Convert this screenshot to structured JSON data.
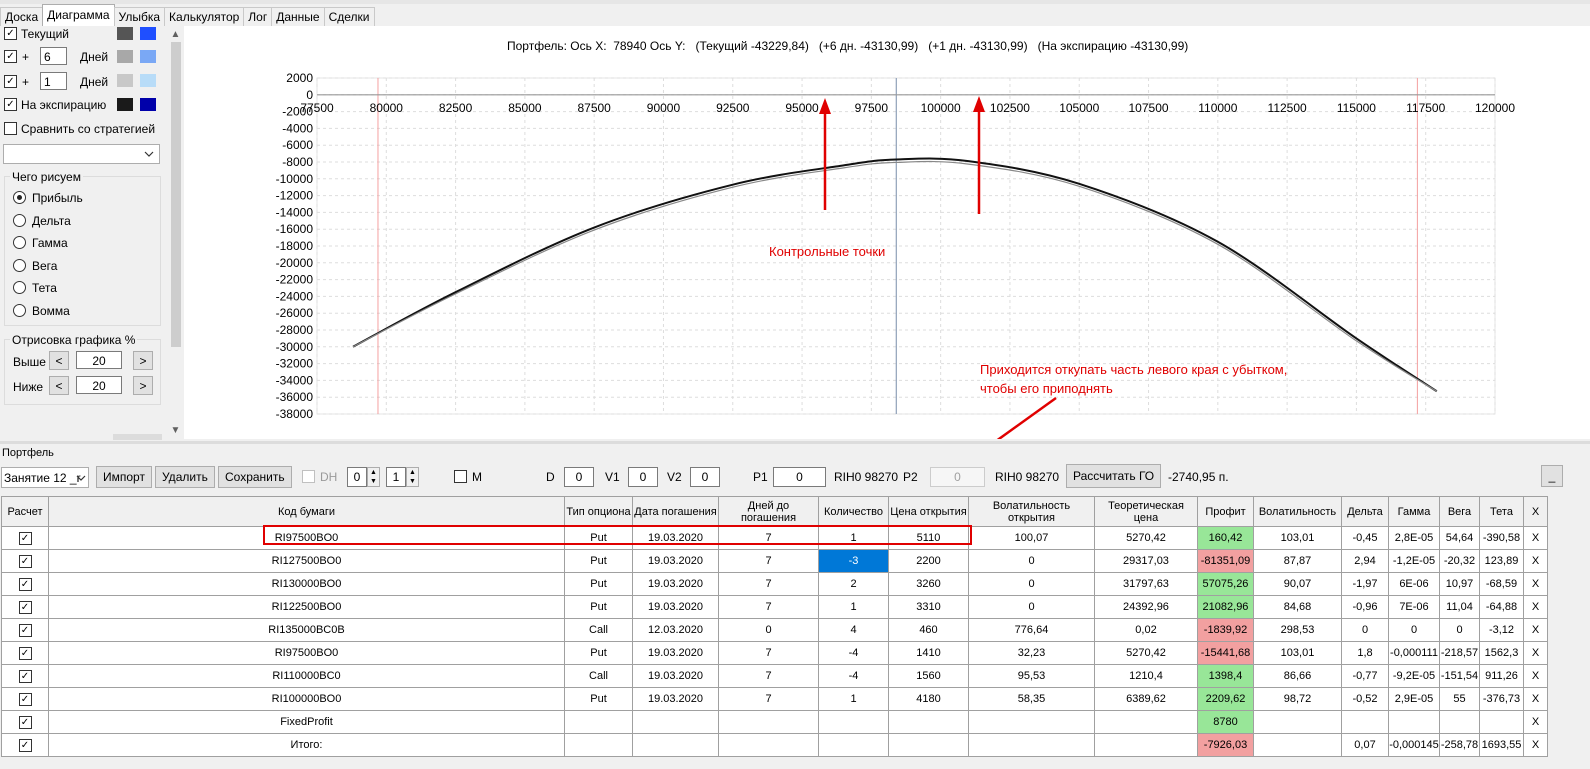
{
  "tabs": [
    "Доска",
    "Диаграмма",
    "Улыбка",
    "Калькулятор",
    "Лог",
    "Данные",
    "Сделки"
  ],
  "active_tab": "Диаграмма",
  "left": {
    "current_label": "Текущий",
    "plus1": {
      "sign": "+",
      "value": "6",
      "unit": "Дней"
    },
    "plus2": {
      "sign": "+",
      "value": "1",
      "unit": "Дней"
    },
    "expiry_label": "На экспирацию",
    "compare_label": "Сравнить со стратегией",
    "what_title": "Чего рисуем",
    "radios": [
      "Прибыль",
      "Дельта",
      "Гамма",
      "Вега",
      "Тета",
      "Вомма"
    ],
    "draw_title": "Отрисовка графика %",
    "above_label": "Выше",
    "above_value": "20",
    "below_label": "Ниже",
    "below_value": "20",
    "lt": "<",
    "gt": ">",
    "swatches": {
      "current": [
        "#555555",
        "#1f4fff"
      ],
      "plus1": [
        "#a8a8a8",
        "#7aa8f5"
      ],
      "plus2": [
        "#c8c8c8",
        "#b8dcf8"
      ],
      "expiry": [
        "#1a1a1a",
        "#0000aa"
      ]
    }
  },
  "chart": {
    "header": "Портфель: Ось X:  78940 Ось Y:   (Текущий -43229,84)   (+6 дн. -43130,99)   (+1 дн. -43130,99)   (На экспирацию -43130,99)",
    "annotation1": "Контрольные точки",
    "annotation2_line1": "Приходится откупать часть левого края с убытком,",
    "annotation2_line2": "чтобы его приподнять"
  },
  "chart_data": {
    "type": "line",
    "x_ticks": [
      77500,
      80000,
      82500,
      85000,
      87500,
      90000,
      92500,
      95000,
      97500,
      100000,
      102500,
      105000,
      107500,
      110000,
      112500,
      115000,
      117500,
      120000
    ],
    "y_ticks": [
      2000,
      0,
      -2000,
      -4000,
      -6000,
      -8000,
      -10000,
      -12000,
      -14000,
      -16000,
      -18000,
      -20000,
      -22000,
      -24000,
      -26000,
      -28000,
      -30000,
      -32000,
      -34000,
      -36000,
      -38000
    ],
    "xlim": [
      77500,
      120000
    ],
    "ylim": [
      -38000,
      2000
    ],
    "series": [
      {
        "points": [
          [
            78800,
            -30000
          ],
          [
            82500,
            -23500
          ],
          [
            87500,
            -15800
          ],
          [
            92500,
            -10700
          ],
          [
            96500,
            -8400
          ],
          [
            98400,
            -7700
          ],
          [
            101000,
            -7900
          ],
          [
            105000,
            -10600
          ],
          [
            110000,
            -17500
          ],
          [
            115000,
            -29000
          ],
          [
            117900,
            -35300
          ]
        ]
      },
      {
        "points": [
          [
            78800,
            -30000
          ],
          [
            82500,
            -23700
          ],
          [
            87500,
            -16100
          ],
          [
            92500,
            -11000
          ],
          [
            96500,
            -8700
          ],
          [
            98400,
            -8050
          ],
          [
            101000,
            -8250
          ],
          [
            105000,
            -10900
          ],
          [
            110000,
            -17800
          ],
          [
            115000,
            -29300
          ],
          [
            117900,
            -35300
          ]
        ]
      }
    ],
    "current_price_x": 98400,
    "bounds_x": [
      79700,
      117200
    ]
  },
  "portfolio_label": "Портфель",
  "toolbar": {
    "combo": "Занятие 12 _r",
    "import": "Импорт",
    "delete": "Удалить",
    "save": "Сохранить",
    "dh": "DH",
    "spin1": "0",
    "spin2": "1",
    "m": "M",
    "d_label": "D",
    "d_val": "0",
    "v1_label": "V1",
    "v1_val": "0",
    "v2_label": "V2",
    "v2_val": "0",
    "p1_label": "P1",
    "p1_val": "0",
    "p1_ticker": "RIH0 98270",
    "p2_label": "P2",
    "p2_val": "0",
    "p2_ticker": "RIH0 98270",
    "calc_go": "Рассчитать ГО",
    "go_value": "-2740,95 п.",
    "small_btn": "_"
  },
  "table": {
    "headers": [
      "Расчет",
      "Код бумаги",
      "Тип опциона",
      "Дата погашения",
      "Дней до погашения",
      "Количество",
      "Цена открытия",
      "Волатильность открытия",
      "Теоретическая цена",
      "Профит",
      "Волатильность",
      "Дельта",
      "Гамма",
      "Вега",
      "Тета",
      "X"
    ],
    "rows": [
      {
        "code": "RI97500BO0",
        "type": "Put",
        "date": "19.03.2020",
        "days": "7",
        "qty": "1",
        "price": "5110",
        "vol_open": "100,07",
        "theo": "5270,42",
        "profit": "160,42",
        "profit_color": "green",
        "vol": "103,01",
        "delta": "-0,45",
        "gamma": "2,8E-05",
        "vega": "54,64",
        "theta": "-390,58",
        "x": "X"
      },
      {
        "code": "RI127500BO0",
        "type": "Put",
        "date": "19.03.2020",
        "days": "7",
        "qty": "-3",
        "price": "2200",
        "vol_open": "0",
        "theo": "29317,03",
        "profit": "-81351,09",
        "profit_color": "red",
        "vol": "87,87",
        "delta": "2,94",
        "gamma": "-1,2E-05",
        "vega": "-20,32",
        "theta": "123,89",
        "x": "X"
      },
      {
        "code": "RI130000BO0",
        "type": "Put",
        "date": "19.03.2020",
        "days": "7",
        "qty": "2",
        "price": "3260",
        "vol_open": "0",
        "theo": "31797,63",
        "profit": "57075,26",
        "profit_color": "green",
        "vol": "90,07",
        "delta": "-1,97",
        "gamma": "6E-06",
        "vega": "10,97",
        "theta": "-68,59",
        "x": "X"
      },
      {
        "code": "RI122500BO0",
        "type": "Put",
        "date": "19.03.2020",
        "days": "7",
        "qty": "1",
        "price": "3310",
        "vol_open": "0",
        "theo": "24392,96",
        "profit": "21082,96",
        "profit_color": "green",
        "vol": "84,68",
        "delta": "-0,96",
        "gamma": "7E-06",
        "vega": "11,04",
        "theta": "-64,88",
        "x": "X"
      },
      {
        "code": "RI135000BC0B",
        "type": "Call",
        "date": "12.03.2020",
        "days": "0",
        "qty": "4",
        "price": "460",
        "vol_open": "776,64",
        "theo": "0,02",
        "profit": "-1839,92",
        "profit_color": "red",
        "vol": "298,53",
        "delta": "0",
        "gamma": "0",
        "vega": "0",
        "theta": "-3,12",
        "x": "X"
      },
      {
        "code": "RI97500BO0",
        "type": "Put",
        "date": "19.03.2020",
        "days": "7",
        "qty": "-4",
        "price": "1410",
        "vol_open": "32,23",
        "theo": "5270,42",
        "profit": "-15441,68",
        "profit_color": "red",
        "vol": "103,01",
        "delta": "1,8",
        "gamma": "-0,000111",
        "vega": "-218,57",
        "theta": "1562,3",
        "x": "X"
      },
      {
        "code": "RI110000BC0",
        "type": "Call",
        "date": "19.03.2020",
        "days": "7",
        "qty": "-4",
        "price": "1560",
        "vol_open": "95,53",
        "theo": "1210,4",
        "profit": "1398,4",
        "profit_color": "green",
        "vol": "86,66",
        "delta": "-0,77",
        "gamma": "-9,2E-05",
        "vega": "-151,54",
        "theta": "911,26",
        "x": "X"
      },
      {
        "code": "RI100000BO0",
        "type": "Put",
        "date": "19.03.2020",
        "days": "7",
        "qty": "1",
        "price": "4180",
        "vol_open": "58,35",
        "theo": "6389,62",
        "profit": "2209,62",
        "profit_color": "green",
        "vol": "98,72",
        "delta": "-0,52",
        "gamma": "2,9E-05",
        "vega": "55",
        "theta": "-376,73",
        "x": "X"
      },
      {
        "code": "FixedProfit",
        "type": "",
        "date": "",
        "days": "",
        "qty": "",
        "price": "",
        "vol_open": "",
        "theo": "",
        "profit": "8780",
        "profit_color": "green",
        "vol": "",
        "delta": "",
        "gamma": "",
        "vega": "",
        "theta": "",
        "x": "X"
      },
      {
        "code": "Итого:",
        "type": "",
        "date": "",
        "days": "",
        "qty": "",
        "price": "",
        "vol_open": "",
        "theo": "",
        "profit": "-7926,03",
        "profit_color": "red",
        "vol": "",
        "delta": "0,07",
        "gamma": "-0,000145",
        "vega": "-258,78",
        "theta": "1693,55",
        "x": "X"
      }
    ]
  },
  "colors": {
    "annotation": "#e00000",
    "profit_green": "#98e698",
    "profit_red": "#f2a0a0",
    "selected": "#0078d7"
  }
}
